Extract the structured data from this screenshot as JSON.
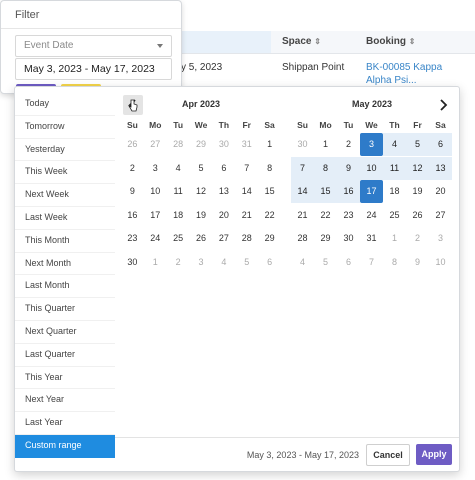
{
  "background_table": {
    "headers": [
      "Space",
      "Booking"
    ],
    "sort_icon": "sort-icon",
    "row": {
      "date_fragment": "y 5, 2023",
      "space": "Shippan Point",
      "booking_line1": "BK-00085 Kappa",
      "booking_line2": "Alpha Psi..."
    },
    "colors": {
      "link": "#3a86c8",
      "header_highlight": "#e8f1fa"
    }
  },
  "filter": {
    "title": "Filter",
    "field_select": {
      "value": "Event Date",
      "icon": "chevron-down-icon"
    },
    "date_input": {
      "value": "May 3, 2023 - May 17, 2023"
    }
  },
  "picker": {
    "ranges": [
      "Today",
      "Tomorrow",
      "Yesterday",
      "This Week",
      "Next Week",
      "Last Week",
      "This Month",
      "Next Month",
      "Last Month",
      "This Quarter",
      "Next Quarter",
      "Last Quarter",
      "This Year",
      "Next Year",
      "Last Year",
      "Custom range"
    ],
    "active_range": "Custom range",
    "weekdays": [
      "Su",
      "Mo",
      "Tu",
      "We",
      "Th",
      "Fr",
      "Sa"
    ],
    "left_month": {
      "title": "Apr 2023",
      "weeks": [
        [
          "26",
          "27",
          "28",
          "29",
          "30",
          "31",
          "1"
        ],
        [
          "2",
          "3",
          "4",
          "5",
          "6",
          "7",
          "8"
        ],
        [
          "9",
          "10",
          "11",
          "12",
          "13",
          "14",
          "15"
        ],
        [
          "16",
          "17",
          "18",
          "19",
          "20",
          "21",
          "22"
        ],
        [
          "23",
          "24",
          "25",
          "26",
          "27",
          "28",
          "29"
        ],
        [
          "30",
          "1",
          "2",
          "3",
          "4",
          "5",
          "6"
        ]
      ],
      "outside": [
        [
          0,
          0
        ],
        [
          0,
          1
        ],
        [
          0,
          2
        ],
        [
          0,
          3
        ],
        [
          0,
          4
        ],
        [
          0,
          5
        ],
        [
          5,
          1
        ],
        [
          5,
          2
        ],
        [
          5,
          3
        ],
        [
          5,
          4
        ],
        [
          5,
          5
        ],
        [
          5,
          6
        ]
      ]
    },
    "right_month": {
      "title": "May 2023",
      "weeks": [
        [
          "30",
          "1",
          "2",
          "3",
          "4",
          "5",
          "6"
        ],
        [
          "7",
          "8",
          "9",
          "10",
          "11",
          "12",
          "13"
        ],
        [
          "14",
          "15",
          "16",
          "17",
          "18",
          "19",
          "20"
        ],
        [
          "21",
          "22",
          "23",
          "24",
          "25",
          "26",
          "27"
        ],
        [
          "28",
          "29",
          "30",
          "31",
          "1",
          "2",
          "3"
        ],
        [
          "4",
          "5",
          "6",
          "7",
          "8",
          "9",
          "10"
        ]
      ],
      "outside": [
        [
          0,
          0
        ],
        [
          4,
          4
        ],
        [
          4,
          5
        ],
        [
          4,
          6
        ],
        [
          5,
          0
        ],
        [
          5,
          1
        ],
        [
          5,
          2
        ],
        [
          5,
          3
        ],
        [
          5,
          4
        ],
        [
          5,
          5
        ],
        [
          5,
          6
        ]
      ],
      "range_start": [
        0,
        3
      ],
      "range_end": [
        2,
        3
      ]
    },
    "footer": {
      "selected_text": "May 3, 2023 - May 17, 2023",
      "cancel_label": "Cancel",
      "apply_label": "Apply"
    },
    "colors": {
      "active_range_bg": "#1f8ce0",
      "range_fill": "#e4eef8",
      "range_edge": "#2e7bc9",
      "apply_bg": "#6e5cc4"
    }
  }
}
